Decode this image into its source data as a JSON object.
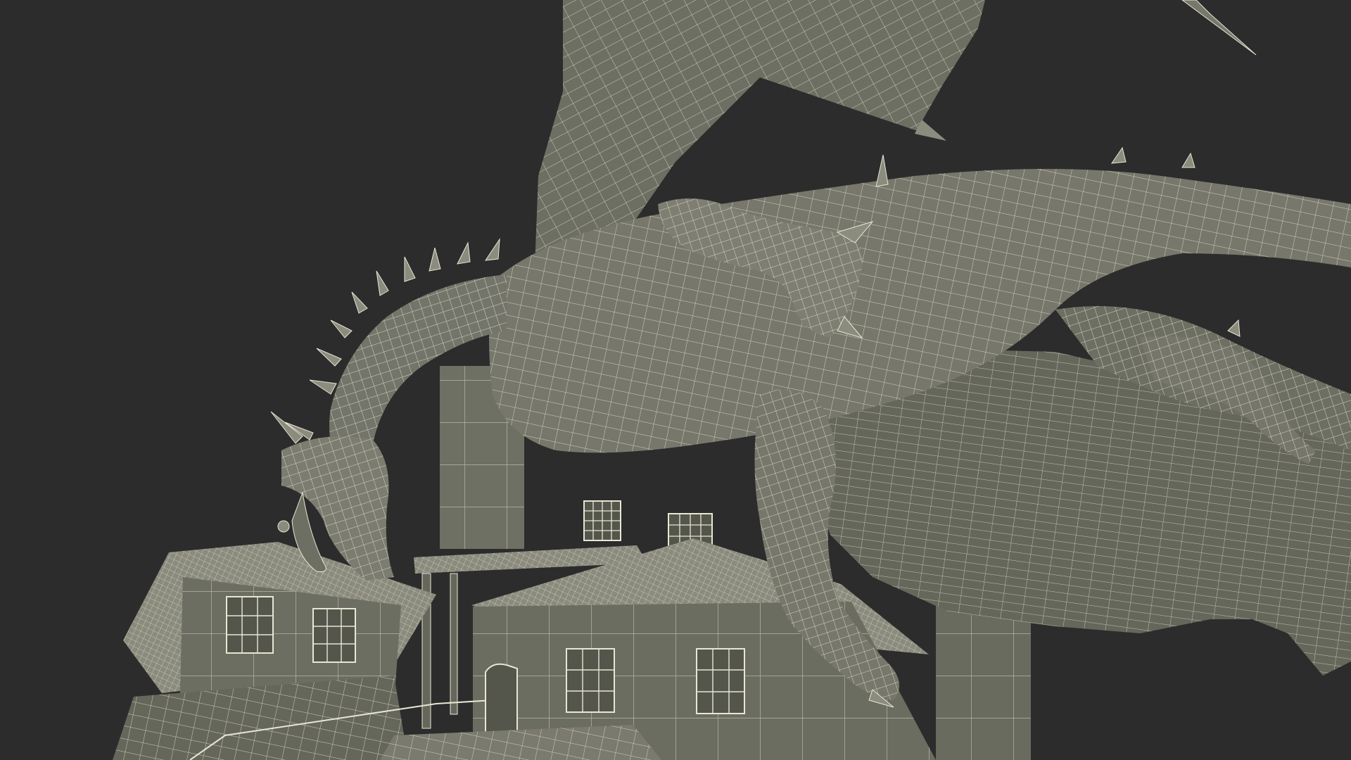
{
  "scene": {
    "background_color": "#2c2c2c",
    "model_fill": "#77786b",
    "model_fill_dark": "#5e5f54",
    "model_fill_light": "#8b8c7e",
    "wire_color": "#e8e6d4",
    "subject": "dragon-on-rooftops-wireframe"
  }
}
